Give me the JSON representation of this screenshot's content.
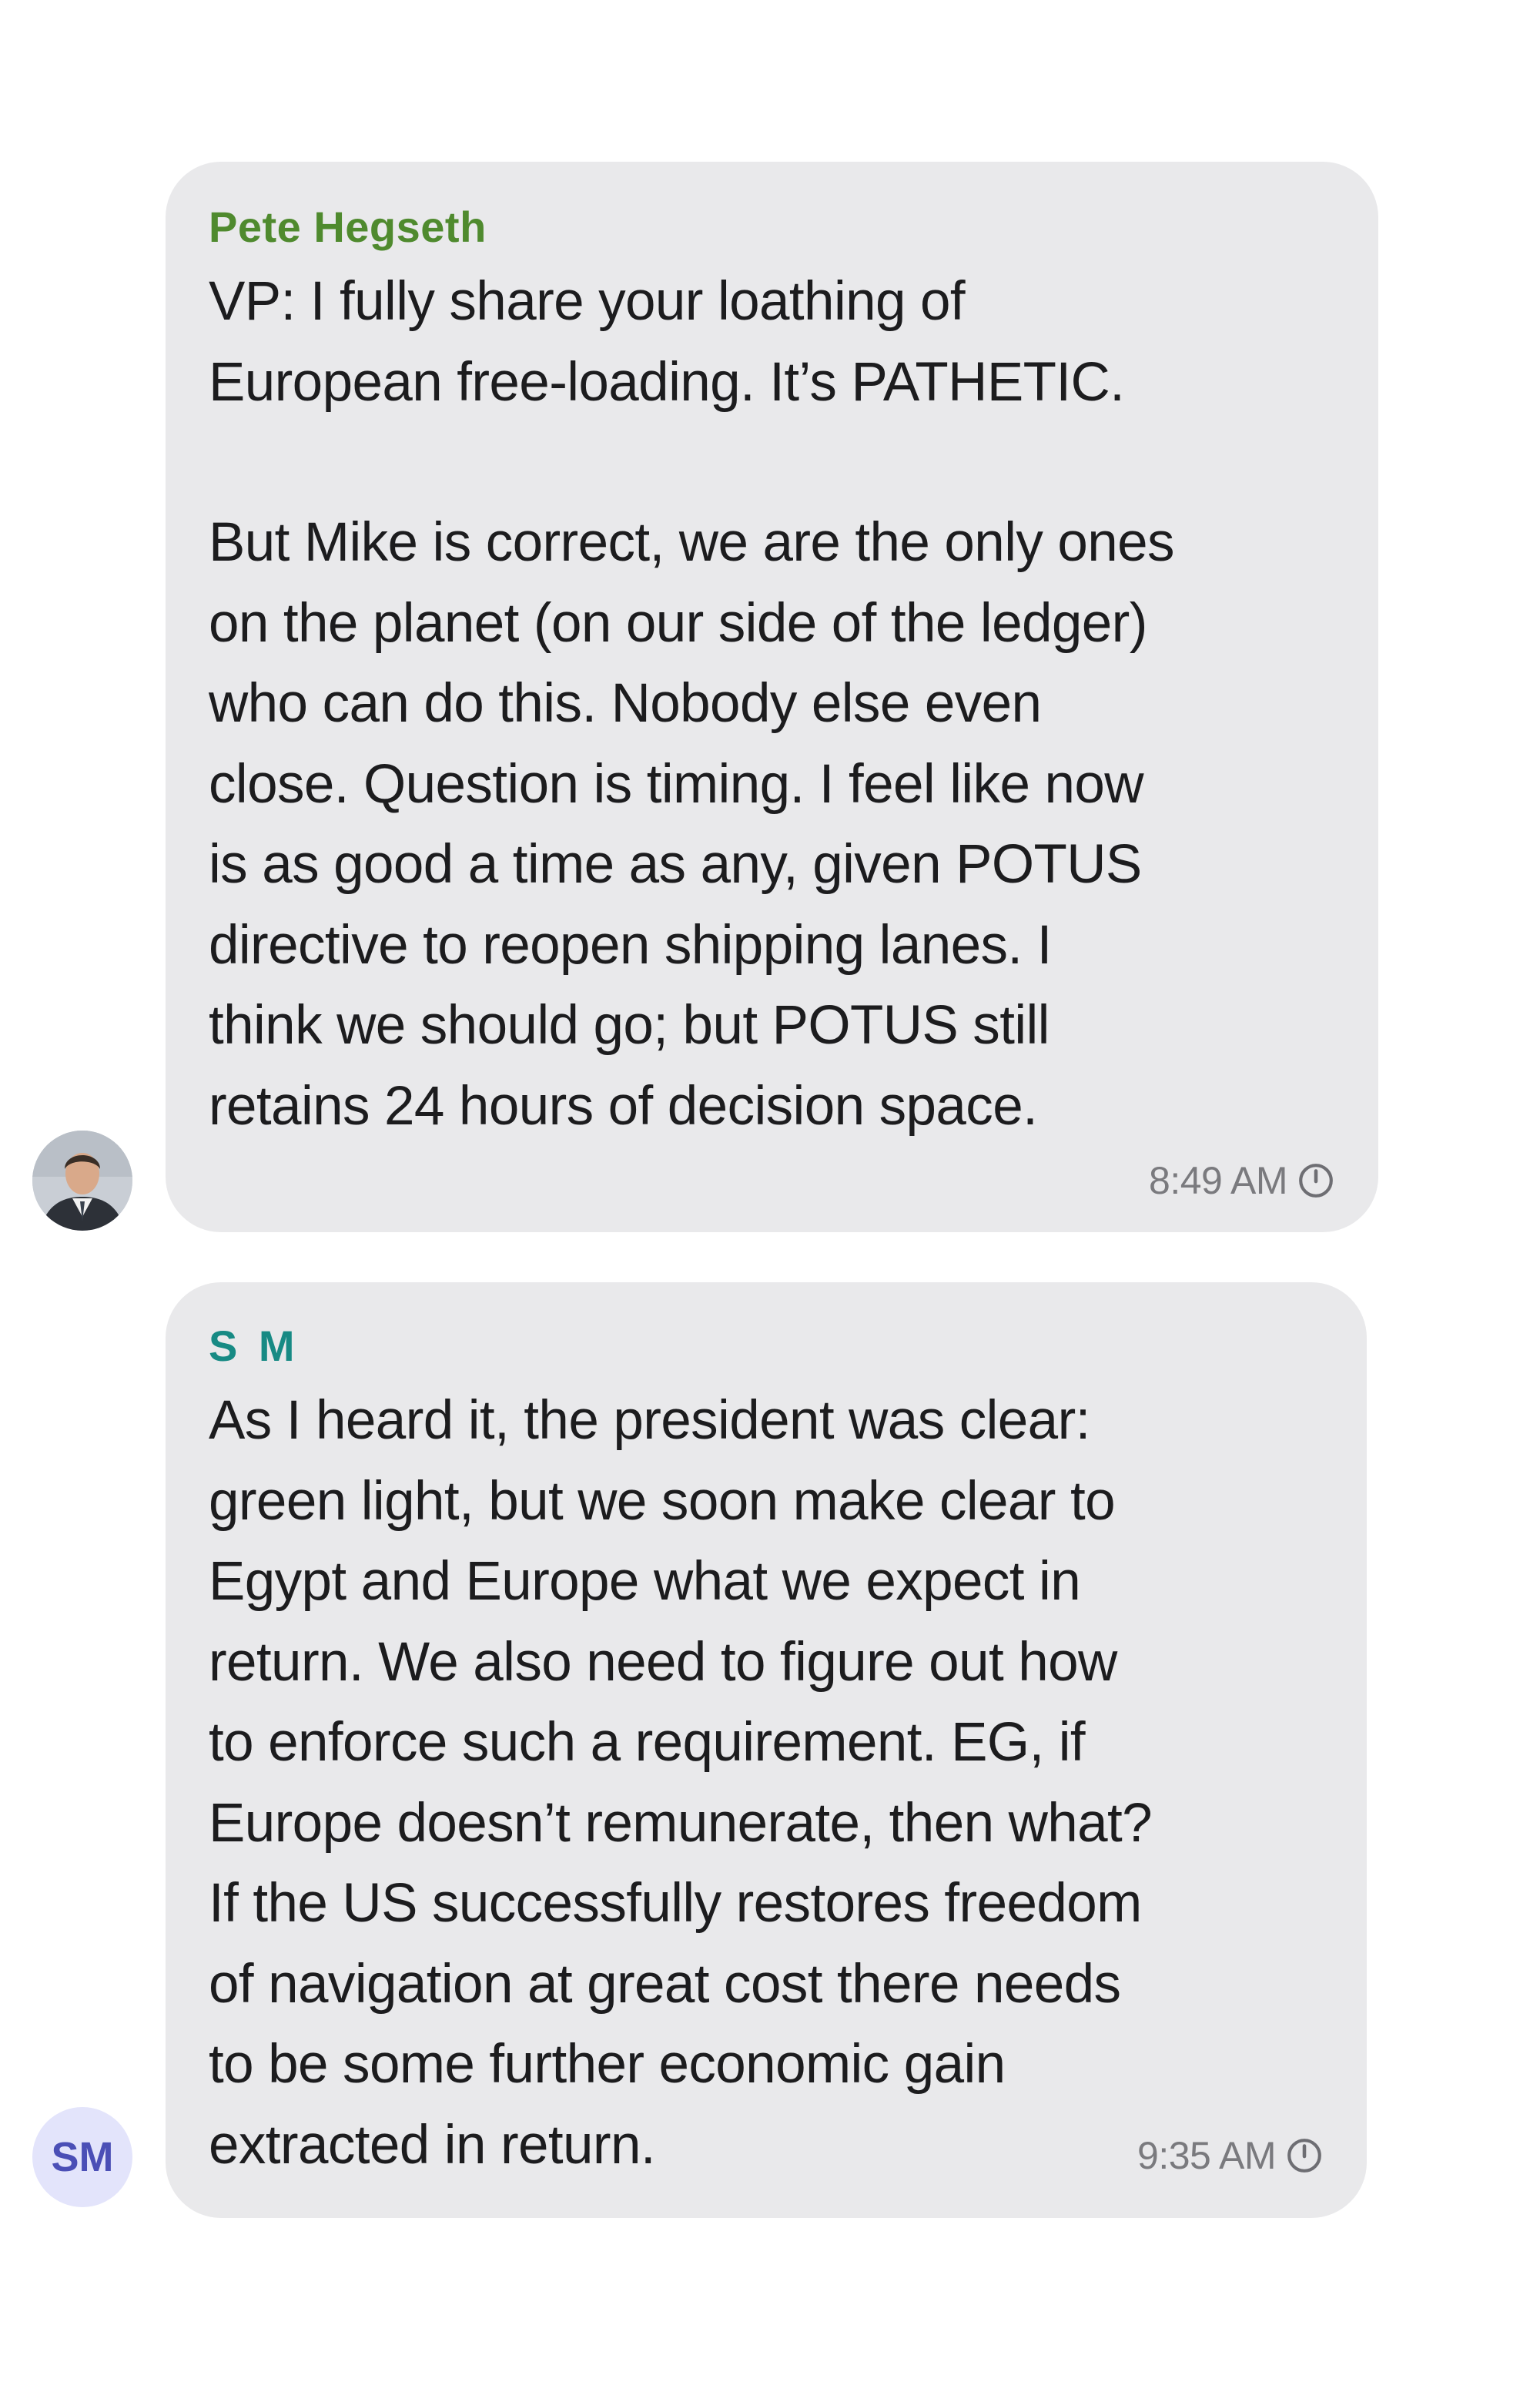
{
  "messages": [
    {
      "sender": "Pete Hegseth",
      "paragraph_1": "VP: I fully share your loathing of\nEuropean free-loading. It’s PATHETIC.",
      "paragraph_2": "But Mike is correct, we are the only ones\non the planet (on our side of the ledger)\nwho can do this. Nobody else even\nclose. Question is timing. I feel like now\nis as good a time as any, given POTUS\ndirective to reopen shipping lanes. I\nthink we should go; but POTUS still\nretains 24 hours of decision space.",
      "time": "8:49 AM",
      "avatar_icon": "person-photo-icon"
    },
    {
      "sender": "S M",
      "paragraph_1": "As I heard it, the president was clear:\ngreen light, but we soon make clear to\nEgypt and Europe what we expect in\nreturn. We also need to figure out how\nto enforce such a requirement. EG, if\nEurope doesn’t remunerate, then what?\nIf the US successfully restores freedom\nof navigation at great cost there needs\nto be some further economic gain\nextracted in return.",
      "time": "9:35 AM",
      "avatar_initials": "SM"
    }
  ],
  "colors": {
    "bubble": "#e9e9eb",
    "sender_pete": "#4f8a2e",
    "sender_sm": "#178a84",
    "timestamp": "#7a7a7e",
    "avatar_sm_bg": "#e3e4fb",
    "avatar_sm_text": "#4b4fb6"
  }
}
